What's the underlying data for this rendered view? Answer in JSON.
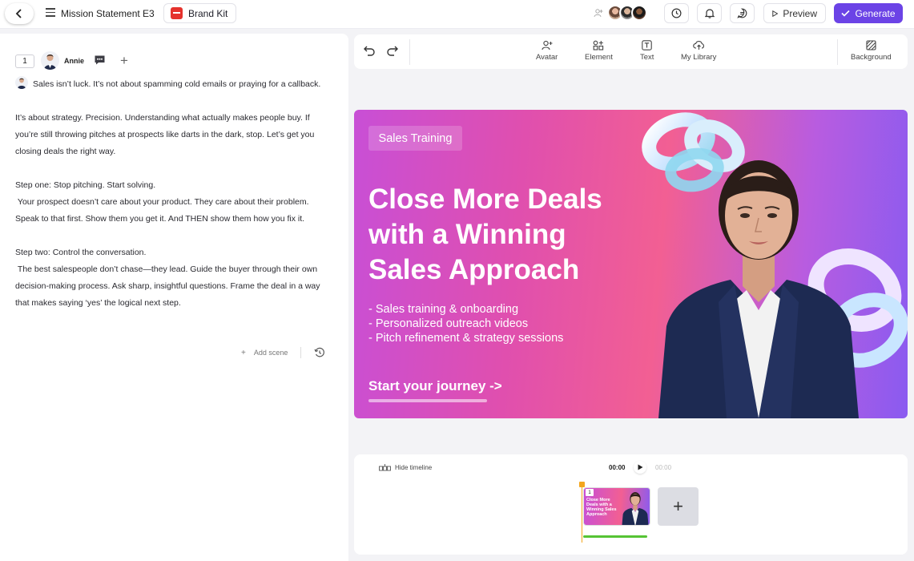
{
  "header": {
    "title": "Mission Statement E3",
    "brand_kit_label": "Brand Kit",
    "preview_label": "Preview",
    "generate_label": "Generate"
  },
  "scene": {
    "number": "1",
    "avatar_name": "Annie",
    "script": [
      "Sales isn’t luck. It’s not about spamming cold emails or praying for a callback.",
      "It’s about strategy. Precision. Understanding what actually makes people buy. If you’re still throwing pitches at prospects like darts in the dark, stop. Let’s get you closing deals the right way.",
      "Step one: Stop pitching. Start solving.\n Your prospect doesn’t care about your product. They care about their problem. Speak to that first. Show them you get it. And THEN show them how you fix it.",
      "Step two: Control the conversation.\n The best salespeople don’t chase—they lead. Guide the buyer through their own decision-making process. Ask sharp, insightful questions. Frame the deal in a way that makes saying ‘yes’ the logical next step."
    ],
    "add_scene_label": "Add scene"
  },
  "toolbar": {
    "tools": [
      {
        "label": "Avatar",
        "icon": "avatar-add-icon"
      },
      {
        "label": "Element",
        "icon": "element-icon"
      },
      {
        "label": "Text",
        "icon": "text-icon"
      },
      {
        "label": "My Library",
        "icon": "upload-cloud-icon"
      }
    ],
    "background_label": "Background"
  },
  "canvas": {
    "tag": "Sales Training",
    "headline": "Close More Deals with a Winning Sales Approach",
    "bullets": [
      "- Sales training & onboarding",
      "- Personalized outreach videos",
      "- Pitch refinement & strategy sessions"
    ],
    "cta": "Start your journey ->"
  },
  "timeline": {
    "hide_label": "Hide timeline",
    "current_time": "00:00",
    "end_time": "00:00",
    "thumb_number": "1",
    "thumb_headline": "Close More Deals with a Winning Sales Approach",
    "progress": 1.0,
    "add_label": "+"
  },
  "colors": {
    "accent": "#6b43e6",
    "brand_red": "#e5322d",
    "timeline_marker": "#f3a61d",
    "progress": "#56c434"
  }
}
